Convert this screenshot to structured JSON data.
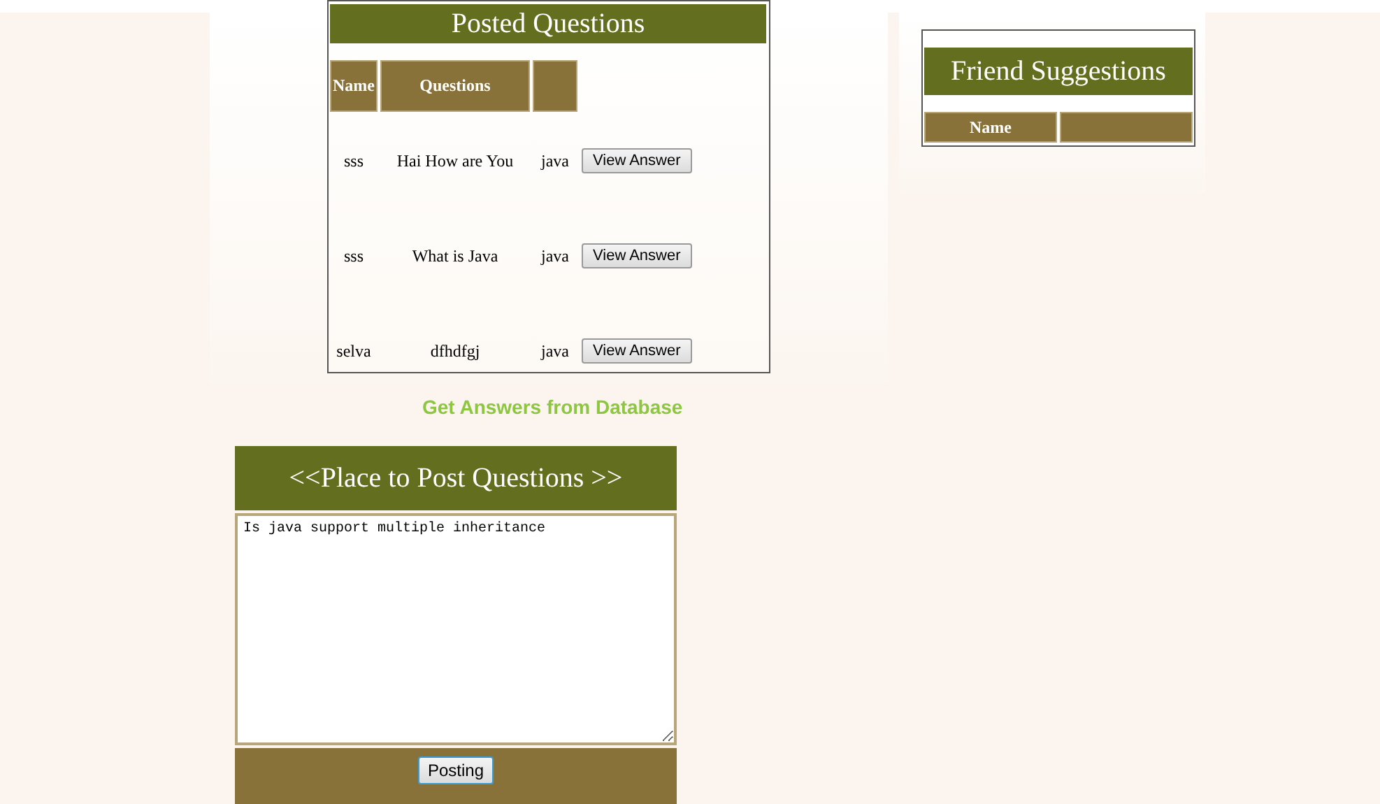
{
  "posted_questions": {
    "title": "Posted Questions",
    "columns": [
      "Name",
      "Questions"
    ],
    "rows": [
      {
        "name": "sss",
        "question": "Hai How are You",
        "topic": "java",
        "button": "View Answer"
      },
      {
        "name": "sss",
        "question": "What is Java",
        "topic": "java",
        "button": "View Answer"
      },
      {
        "name": "selva",
        "question": "dfhdfgj",
        "topic": "java",
        "button": "View Answer"
      }
    ]
  },
  "answers_link": "Get Answers from Database",
  "post_form": {
    "title": "<<Place to Post Questions >>",
    "question": "Is java support multiple inheritance",
    "button": "Posting"
  },
  "friend_suggestions": {
    "title": "Friend Suggestions",
    "columns": [
      "Name"
    ]
  }
}
